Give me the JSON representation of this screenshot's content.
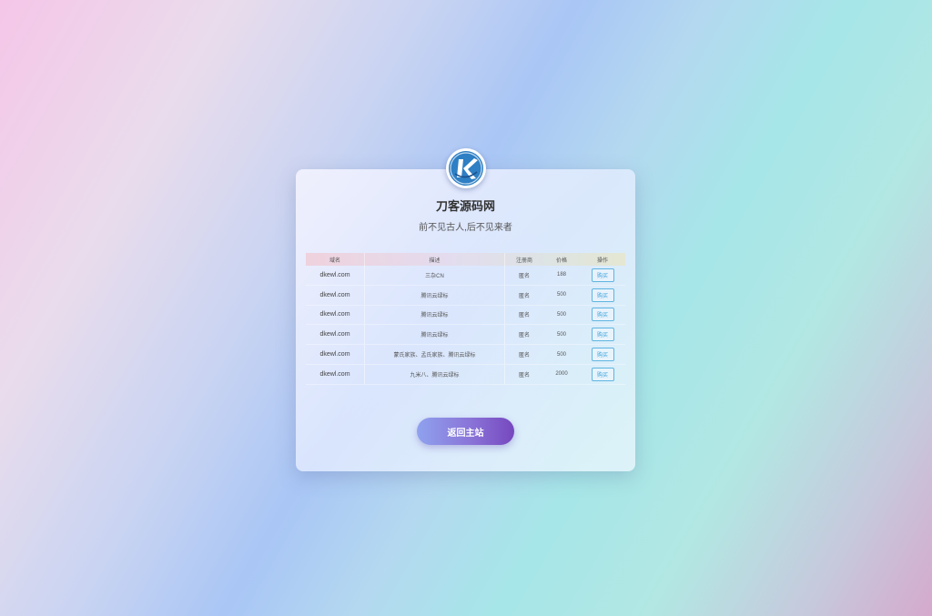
{
  "site": {
    "title": "刀客源码网",
    "subtitle": "前不见古人,后不见来者",
    "logo_letter": "K"
  },
  "table": {
    "headers": [
      "域名",
      "描述",
      "注册商",
      "价格",
      "操作"
    ],
    "rows": [
      {
        "domain": "dkewl.com",
        "desc": "三杂CN",
        "registrar": "匿名",
        "price": "188",
        "action": "购买"
      },
      {
        "domain": "dkewl.com",
        "desc": "腾讯云绿标",
        "registrar": "匿名",
        "price": "500",
        "action": "购买"
      },
      {
        "domain": "dkewl.com",
        "desc": "腾讯云绿标",
        "registrar": "匿名",
        "price": "500",
        "action": "购买"
      },
      {
        "domain": "dkewl.com",
        "desc": "腾讯云绿标",
        "registrar": "匿名",
        "price": "500",
        "action": "购买"
      },
      {
        "domain": "dkewl.com",
        "desc": "蒙氏家族、孟氏家族、腾讯云绿标",
        "registrar": "匿名",
        "price": "500",
        "action": "购买"
      },
      {
        "domain": "dkewl.com",
        "desc": "九米八、腾讯云绿标",
        "registrar": "匿名",
        "price": "2000",
        "action": "购买"
      }
    ]
  },
  "home_button": {
    "label": "返回主站"
  },
  "colors": {
    "accent_blue": "#3aa0d8",
    "button_gradient_start": "#8fa2ee",
    "button_gradient_end": "#7648be"
  }
}
